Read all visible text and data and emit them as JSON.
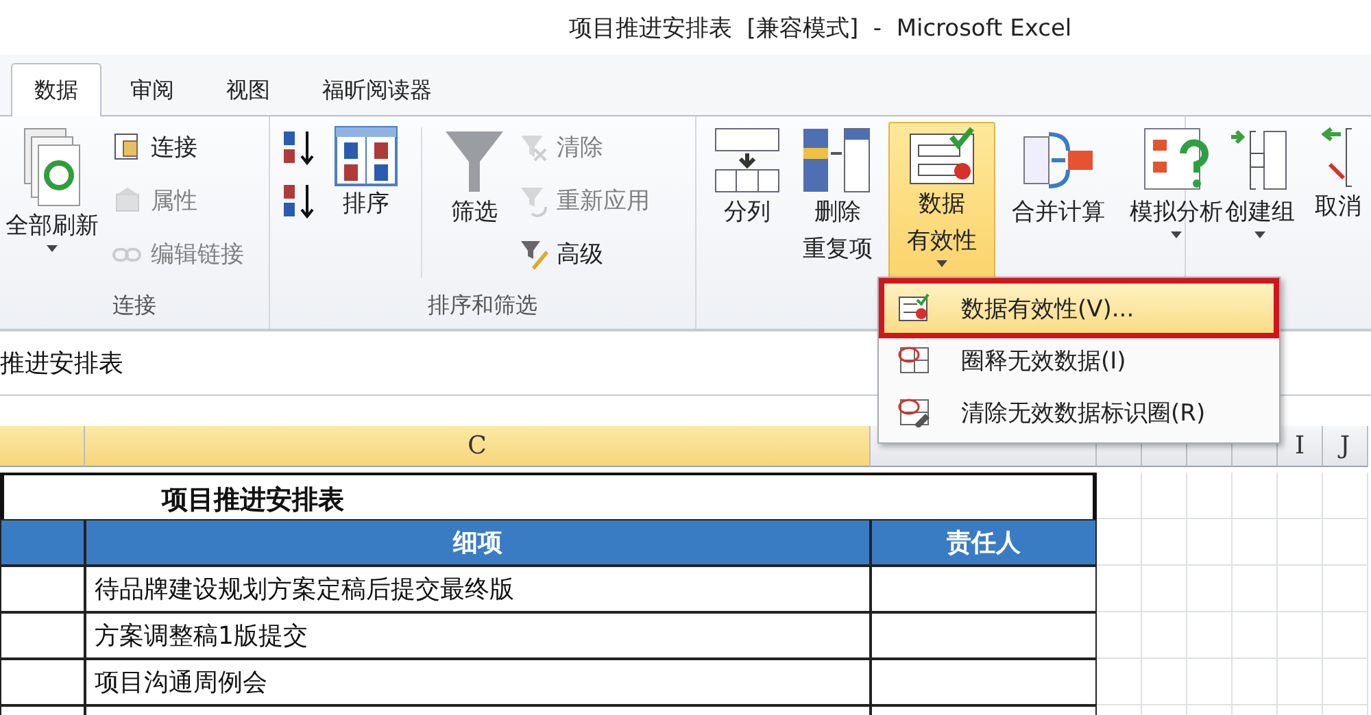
{
  "window": {
    "title": "项目推进安排表  [兼容模式]  -  Microsoft Excel"
  },
  "tabs": [
    {
      "label": "数据",
      "selected": true
    },
    {
      "label": "审阅",
      "selected": false
    },
    {
      "label": "视图",
      "selected": false
    },
    {
      "label": "福昕阅读器",
      "selected": false
    }
  ],
  "ribbon": {
    "groups": [
      {
        "label": "连接",
        "items": [
          {
            "kind": "large",
            "lines": [
              "全部刷新"
            ],
            "dropdown": true,
            "active": false
          },
          {
            "kind": "stack",
            "buttons": [
              {
                "label": "连接",
                "disabled": false
              },
              {
                "label": "属性",
                "disabled": true
              },
              {
                "label": "编辑链接",
                "disabled": true
              }
            ]
          }
        ]
      },
      {
        "label": "排序和筛选",
        "items": [
          {
            "kind": "stack",
            "buttons": [
              {
                "disabled": false
              },
              {
                "disabled": false
              }
            ]
          },
          {
            "kind": "large",
            "lines": [
              "排序"
            ],
            "dropdown": false,
            "active": false
          },
          {
            "kind": "separator"
          },
          {
            "kind": "large",
            "lines": [
              "筛选"
            ],
            "dropdown": false,
            "active": false
          },
          {
            "kind": "stack",
            "buttons": [
              {
                "label": "清除",
                "disabled": true
              },
              {
                "label": "重新应用",
                "disabled": true
              },
              {
                "label": "高级",
                "disabled": false
              }
            ]
          }
        ]
      },
      {
        "items": [
          {
            "kind": "large",
            "lines": [
              "分列"
            ],
            "dropdown": false,
            "active": false
          },
          {
            "kind": "large",
            "lines": [
              "删除",
              "重复项"
            ],
            "dropdown": false,
            "active": false
          },
          {
            "kind": "large",
            "lines": [
              "数据",
              "有效性"
            ],
            "dropdown": true,
            "active": true
          },
          {
            "kind": "large",
            "lines": [
              "合并计算"
            ],
            "dropdown": false,
            "active": false
          },
          {
            "kind": "large",
            "lines": [
              "模拟分析"
            ],
            "dropdown": true,
            "active": false
          }
        ]
      },
      {
        "items": [
          {
            "kind": "large",
            "lines": [
              "创建组"
            ],
            "dropdown": true,
            "active": false
          },
          {
            "kind": "large",
            "lines": [
              "取消"
            ],
            "dropdown": false,
            "active": false
          }
        ]
      }
    ]
  },
  "formula_bar": {
    "value": "推进安排表"
  },
  "menu": {
    "items": [
      {
        "label": "数据有效性(V)...",
        "selected": true
      },
      {
        "label": "圈释无效数据(I)",
        "selected": false
      },
      {
        "label": "清除无效数据标识圈(R)",
        "selected": false
      }
    ]
  },
  "sheet": {
    "columns": [
      {
        "selected": true
      },
      {
        "label": "C",
        "selected": true
      },
      {
        "selected": false
      },
      {
        "selected": false
      },
      {
        "selected": false
      },
      {
        "selected": false
      },
      {
        "selected": false
      },
      {
        "label": "I",
        "selected": false
      },
      {
        "label": "J",
        "selected": false
      }
    ],
    "title": "项目推进安排表",
    "headers": [
      "细项",
      "责任人"
    ],
    "rows": [
      [
        "待品牌建设规划方案定稿后提交最终版"
      ],
      [
        "方案调整稿1版提交"
      ],
      [
        "项目沟通周例会"
      ]
    ]
  }
}
